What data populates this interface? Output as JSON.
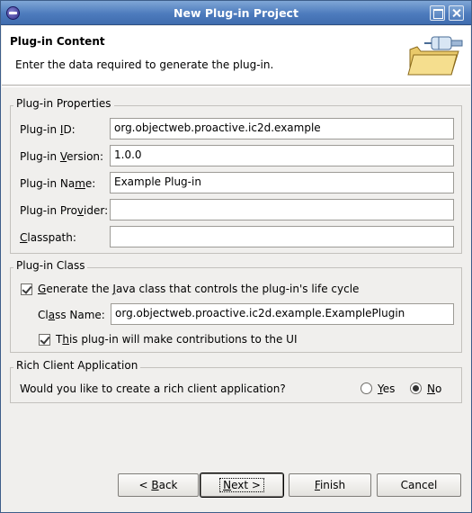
{
  "window": {
    "title": "New Plug-in Project"
  },
  "header": {
    "title": "Plug-in Content",
    "description": "Enter the data required to generate the plug-in."
  },
  "properties": {
    "group_title": "Plug-in Properties",
    "id_label": {
      "pre": "Plug-in ",
      "key": "I",
      "post": "D:"
    },
    "id_value": "org.objectweb.proactive.ic2d.example",
    "version_label": {
      "pre": "Plug-in ",
      "key": "V",
      "post": "ersion:"
    },
    "version_value": "1.0.0",
    "name_label": {
      "pre": "Plug-in Na",
      "key": "m",
      "post": "e:"
    },
    "name_value": "Example Plug-in",
    "provider_label": {
      "pre": "Plug-in Pro",
      "key": "v",
      "post": "ider:"
    },
    "provider_value": "",
    "classpath_label": {
      "pre": "",
      "key": "C",
      "post": "lasspath:"
    },
    "classpath_value": ""
  },
  "plugin_class": {
    "group_title": "Plug-in Class",
    "generate_label": {
      "pre": "",
      "key": "G",
      "mid": "enerate the ",
      "key2": "J",
      "post": "ava class that controls the plug-in's life cycle"
    },
    "generate_checked": true,
    "classname_label": {
      "pre": "Cl",
      "key": "a",
      "post": "ss Name:"
    },
    "classname_value": "org.objectweb.proactive.ic2d.example.ExamplePlugin",
    "ui_label": {
      "pre": "T",
      "key": "h",
      "post": "is plug-in will make contributions to the UI"
    },
    "ui_checked": true
  },
  "rich_client": {
    "group_title": "Rich Client Application",
    "question": "Would you like to create a rich client application?",
    "yes_label": {
      "key": "Y",
      "post": "es"
    },
    "no_label": {
      "key": "N",
      "post": "o"
    },
    "selected": "No"
  },
  "buttons": {
    "back": {
      "pre": "< ",
      "key": "B",
      "post": "ack"
    },
    "next": {
      "key": "N",
      "post": "ext >"
    },
    "finish": {
      "key": "F",
      "post": "inish"
    },
    "cancel": "Cancel"
  }
}
